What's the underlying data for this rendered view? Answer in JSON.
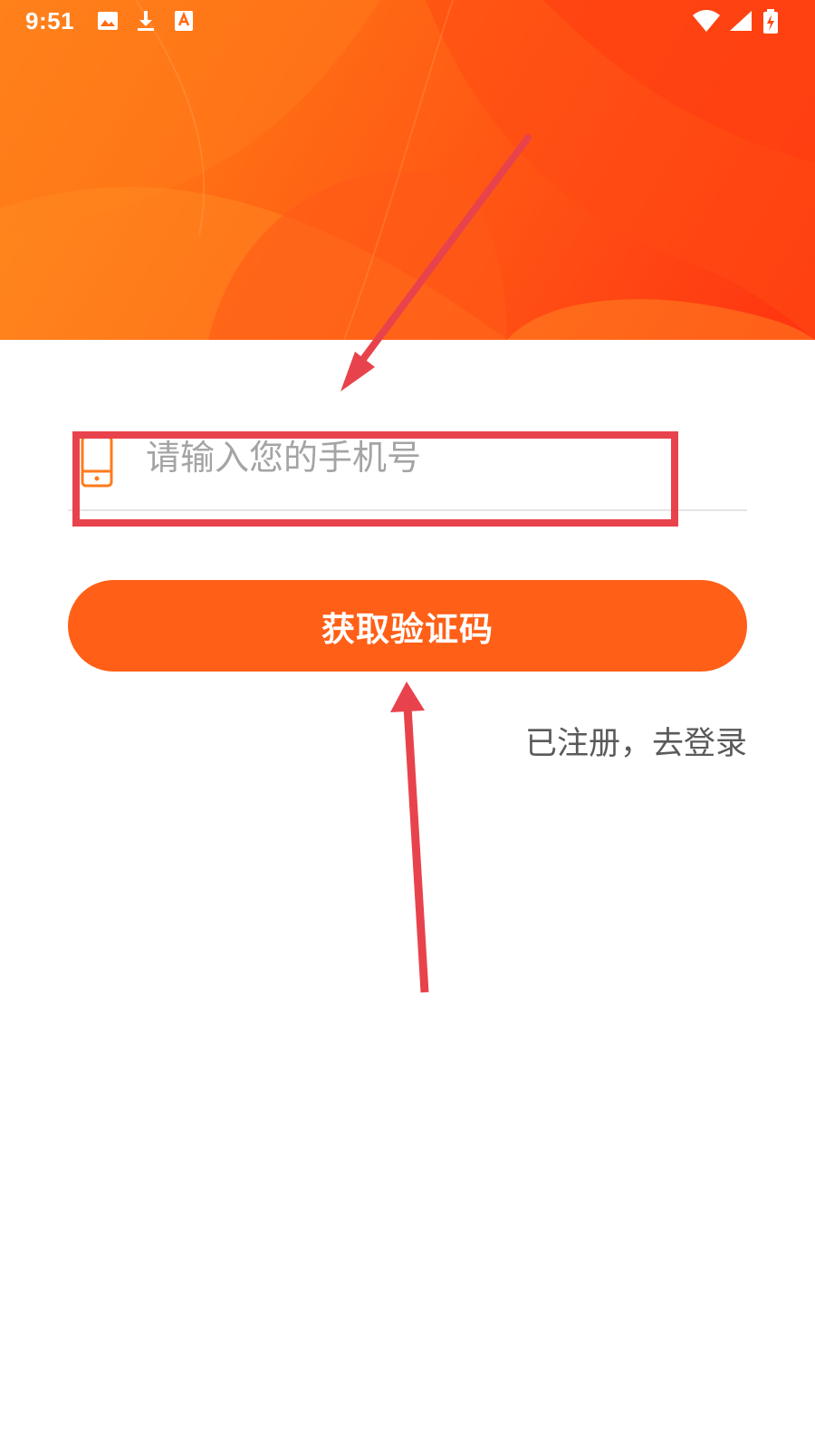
{
  "status_bar": {
    "time": "9:51",
    "left_icons": [
      "image-icon",
      "download-icon",
      "text-recognition-icon"
    ],
    "right_icons": [
      "wifi-icon",
      "signal-icon",
      "battery-charging-icon"
    ]
  },
  "banner": {
    "gradient_colors": [
      "#ff8a1a",
      "#ff6a14",
      "#ff4d14",
      "#ff3310"
    ]
  },
  "phone_field": {
    "icon": "phone-icon",
    "placeholder": "请输入您的手机号",
    "value": ""
  },
  "verify_button": {
    "label": "获取验证码",
    "color": "#ff5f16"
  },
  "login_link": {
    "label": "已注册，去登录"
  },
  "colors": {
    "accent": "#ff5f16",
    "annotation": "#e8434c"
  },
  "annotations": [
    "highlight-box",
    "arrow-to-phone-field",
    "arrow-to-verify-button"
  ]
}
